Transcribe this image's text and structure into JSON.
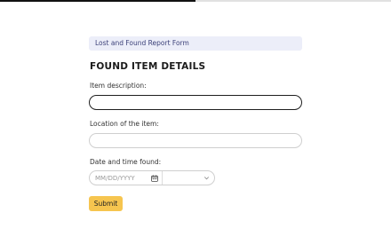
{
  "progress": {
    "fraction": 0.5
  },
  "form": {
    "banner_title": "Lost and Found Report Form",
    "section_heading": "FOUND ITEM DETAILS",
    "fields": {
      "item_description": {
        "label": "Item description:",
        "value": ""
      },
      "location": {
        "label": "Location of the item:",
        "value": ""
      },
      "date_time": {
        "label": "Date and time found:",
        "date_placeholder": "MM/DD/YYYY",
        "time_value": ""
      }
    },
    "submit_label": "Submit"
  },
  "icons": {
    "date_picker": "calendar-icon",
    "time_dropdown": "chevron-down-icon"
  },
  "colors": {
    "banner_background": "#eceef9",
    "banner_text": "#3a3f78",
    "submit_background": "#f6c54f",
    "focused_border": "#1f1f1f"
  }
}
